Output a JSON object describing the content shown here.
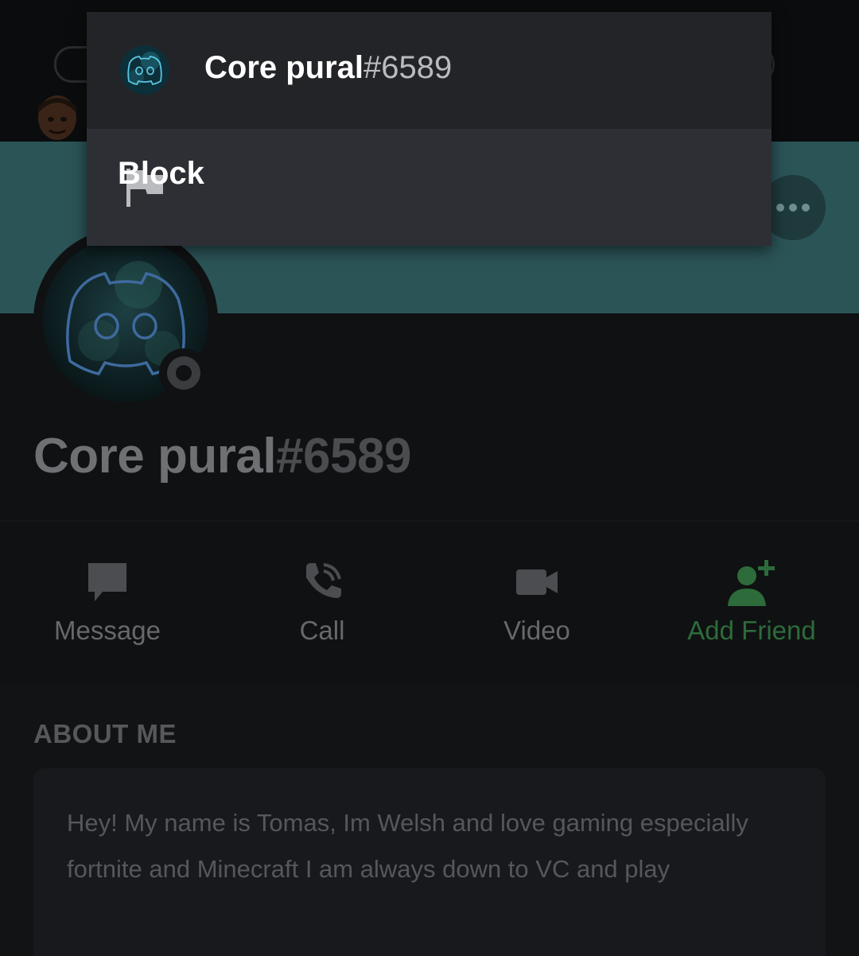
{
  "popup_menu": {
    "user_name": "Core pural",
    "user_tag": "#6589",
    "items": [
      {
        "label": "Block",
        "icon": "flag-icon"
      }
    ]
  },
  "profile": {
    "name": "Core pural",
    "tag": "#6589",
    "status": "offline",
    "banner_color": "#2b5457"
  },
  "actions": [
    {
      "label": "Message",
      "icon": "message-icon"
    },
    {
      "label": "Call",
      "icon": "phone-call-icon"
    },
    {
      "label": "Video",
      "icon": "video-camera-icon"
    },
    {
      "label": "Add Friend",
      "icon": "add-friend-icon",
      "color": "#2d6b3b"
    }
  ],
  "about_me": {
    "title": "ABOUT ME",
    "text": "Hey! My name is Tomas, Im Welsh and love gaming especially fortnite and Minecraft I am always down to VC and play"
  }
}
